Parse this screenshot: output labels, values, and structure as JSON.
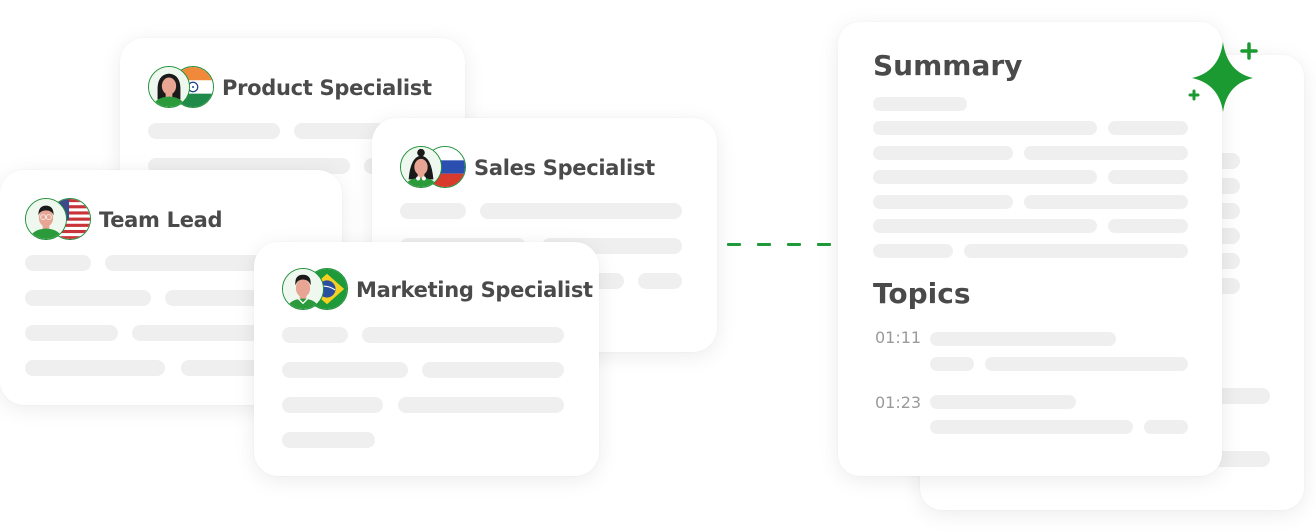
{
  "cards": {
    "product": {
      "title": "Product Specialist",
      "country": "India"
    },
    "team": {
      "title": "Team Lead",
      "country": "USA"
    },
    "sales": {
      "title": "Sales Specialist",
      "country": "Russia"
    },
    "marketing": {
      "title": "Marketing Specialist",
      "country": "Brazil"
    }
  },
  "summary": {
    "title": "Summary",
    "topics_title": "Topics",
    "topics": [
      {
        "time": "01:11"
      },
      {
        "time": "01:23"
      }
    ]
  },
  "icons": {
    "sparkle": "sparkle-icon",
    "connector": "dashed-connector"
  },
  "colors": {
    "accent": "#1f9a3a",
    "title_text": "#4a4a4a",
    "placeholder": "#efefef",
    "timestamp": "#9a9a9a"
  }
}
